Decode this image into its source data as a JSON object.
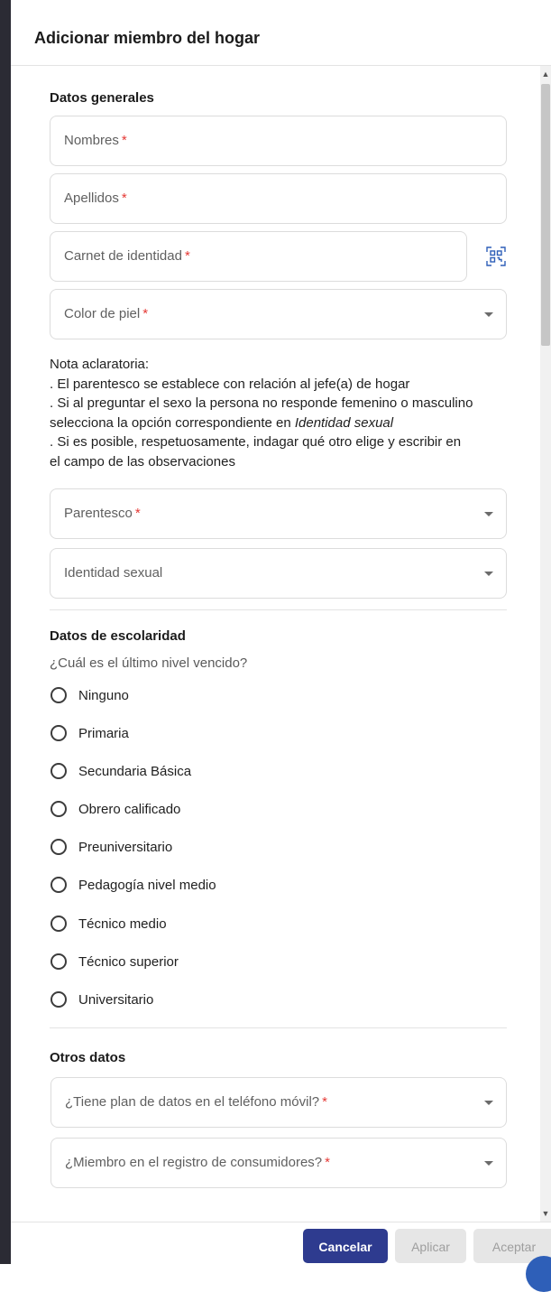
{
  "dialog": {
    "title": "Adicionar miembro del hogar"
  },
  "general": {
    "title": "Datos generales",
    "fields": {
      "nombres": {
        "label": "Nombres",
        "required": "*"
      },
      "apellidos": {
        "label": "Apellidos",
        "required": "*"
      },
      "carnet": {
        "label": "Carnet de identidad",
        "required": "*"
      },
      "color_piel": {
        "label": "Color de piel",
        "required": "*"
      },
      "parentesco": {
        "label": "Parentesco",
        "required": "*"
      },
      "identidad_sexual": {
        "label": "Identidad sexual"
      }
    },
    "note": {
      "title": "Nota aclaratoria:",
      "line1": ". El parentesco se establece con relación al jefe(a) de hogar",
      "line2": ". Si al preguntar el sexo la persona no responde femenino o masculino",
      "line3_pre": "selecciona la opción correspondiente en ",
      "line3_em": "Identidad sexual",
      "line4": ". Si es posible, respetuosamente, indagar qué otro elige y  escribir en",
      "line5": "el campo de las observaciones"
    }
  },
  "schooling": {
    "title": "Datos de escolaridad",
    "question": "¿Cuál es el último nivel vencido?",
    "options": [
      "Ninguno",
      "Primaria",
      "Secundaria Básica",
      "Obrero calificado",
      "Preuniversitario",
      "Pedagogía nivel medio",
      "Técnico medio",
      "Técnico superior",
      "Universitario"
    ]
  },
  "other": {
    "title": "Otros datos",
    "fields": {
      "plan_datos": {
        "label": "¿Tiene plan de datos en el teléfono móvil?",
        "required": "*"
      },
      "registro": {
        "label": "¿Miembro en el registro de consumidores?",
        "required": "*"
      }
    }
  },
  "footer": {
    "cancel": "Cancelar",
    "apply": "Aplicar",
    "accept": "Aceptar"
  },
  "colors": {
    "primary": "#2e3b8f",
    "required": "#e53935",
    "disabled_bg": "#e6e6e6"
  }
}
